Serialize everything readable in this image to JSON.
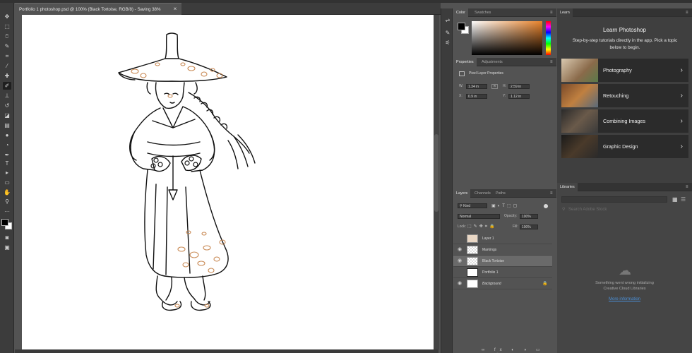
{
  "document": {
    "tab_title": "Portfolio 1 photoshop.psd @ 100% (Black Tortoise, RGB/8) - Saving 38%",
    "close_glyph": "×"
  },
  "toolbar": {
    "tools": [
      "move-tool",
      "marquee-tool",
      "lasso-tool",
      "quick-select-tool",
      "crop-tool",
      "eyedropper-tool",
      "healing-brush-tool",
      "brush-tool",
      "clone-stamp-tool",
      "history-brush-tool",
      "eraser-tool",
      "gradient-tool",
      "blur-tool",
      "dodge-tool",
      "pen-tool",
      "type-tool",
      "path-select-tool",
      "rectangle-tool",
      "hand-tool",
      "zoom-tool",
      "more-tools"
    ],
    "active_tool": "brush-tool"
  },
  "color_panel": {
    "tabs": [
      "Color",
      "Swatches"
    ],
    "foreground": "#000000",
    "background": "#ffffff",
    "hue_color": "#e8822a"
  },
  "properties_panel": {
    "tabs": [
      "Properties",
      "Adjustments"
    ],
    "section_title": "Pixel Layer Properties",
    "w_label": "W:",
    "w_value": "1.34 in",
    "h_label": "H:",
    "h_value": "2.59 in",
    "x_label": "X:",
    "x_value": "0.9 in",
    "y_label": "Y:",
    "y_value": "1.12 in"
  },
  "layers_panel": {
    "tabs": [
      "Layers",
      "Channels",
      "Paths"
    ],
    "filter_label": "Kind",
    "blend_mode": "Normal",
    "opacity_label": "Opacity:",
    "opacity_value": "100%",
    "lock_label": "Lock:",
    "fill_label": "Fill:",
    "fill_value": "100%",
    "layers": [
      {
        "name": "Layer 1",
        "visible": false,
        "selected": false
      },
      {
        "name": "Markings",
        "visible": true,
        "selected": false
      },
      {
        "name": "Black Tortoise",
        "visible": true,
        "selected": true
      },
      {
        "name": "Portfolio 1",
        "visible": false,
        "selected": false
      },
      {
        "name": "Background",
        "visible": true,
        "selected": false,
        "locked": true
      }
    ]
  },
  "learn_panel": {
    "tab": "Learn",
    "title": "Learn Photoshop",
    "subtitle": "Step-by-step tutorials directly in the app. Pick a topic below to begin.",
    "topics": [
      "Photography",
      "Retouching",
      "Combining Images",
      "Graphic Design"
    ]
  },
  "libraries_panel": {
    "tab": "Libraries",
    "search_placeholder": "Search Adobe Stock",
    "error_line1": "Something went wrong initializing",
    "error_line2": "Creative Cloud Libraries",
    "link": "More information"
  },
  "colors": {
    "accent": "#4a90d9",
    "panel_bg": "#535353",
    "dark_bg": "#3c3c3c",
    "marking_color": "#c98a55"
  }
}
